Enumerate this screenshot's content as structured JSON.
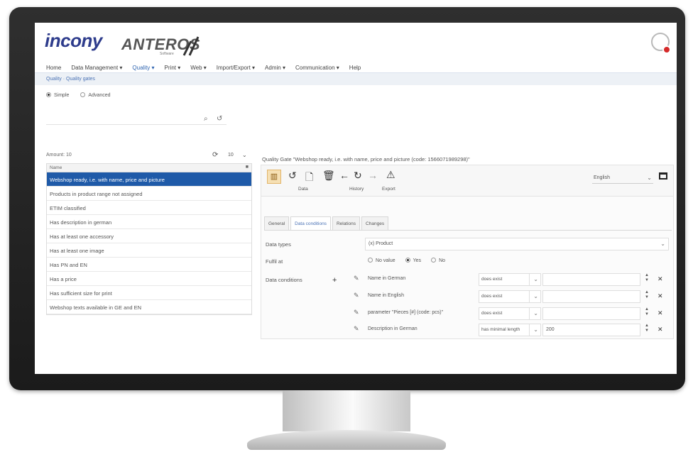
{
  "brand": {
    "logo": "incony",
    "product": "ANTEROS",
    "product_sub": "Software"
  },
  "nav": {
    "items": [
      "Home",
      "Data Management ▾",
      "Quality ▾",
      "Print ▾",
      "Web ▾",
      "Import/Export ▾",
      "Admin ▾",
      "Communication ▾",
      "Help"
    ]
  },
  "breadcrumb": "Quality · Quality gates",
  "search_mode": {
    "simple": "Simple",
    "advanced": "Advanced"
  },
  "list": {
    "amount": "Amount: 10",
    "page_size": "10",
    "column_header": "Name",
    "items": [
      "Webshop ready, i.e. with name, price and picture",
      "Products in product range not assigned",
      "ETIM classified",
      "Has description in german",
      "Has at least one accessory",
      "Has at least one image",
      "Has PN and EN",
      "Has a price",
      "Has sufficient size for print",
      "Webshop texts available in GE and EN"
    ]
  },
  "detail": {
    "title": "Quality Gate \"Webshop ready, i.e. with name, price and picture (code: 1566071989298)\"",
    "toolbar": {
      "data_label": "Data",
      "history_label": "History",
      "export_label": "Export"
    },
    "language": "English",
    "tabs": [
      "General",
      "Data conditions",
      "Relations",
      "Changes"
    ],
    "data_types_label": "Data types",
    "data_types_value": "(x) Product",
    "fulfil_label": "Fulfil at",
    "fulfil_options": [
      "No value",
      "Yes",
      "No"
    ],
    "conditions_label": "Data conditions",
    "conditions": [
      {
        "name": "Name in German",
        "operator": "does exist",
        "value": ""
      },
      {
        "name": "Name in English",
        "operator": "does exist",
        "value": ""
      },
      {
        "name": "parameter \"Pieces [#] (code: pcs)\"",
        "operator": "does exist",
        "value": ""
      },
      {
        "name": "Description in German",
        "operator": "has minimal length",
        "value": "200"
      }
    ]
  }
}
